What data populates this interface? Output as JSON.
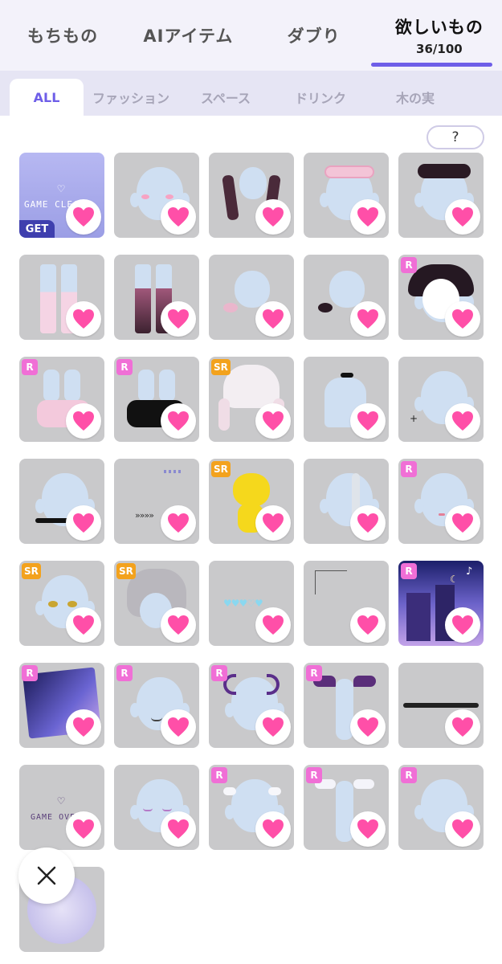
{
  "top_tabs": [
    {
      "label": "もちもの"
    },
    {
      "label": "AIアイテム"
    },
    {
      "label": "ダブり"
    },
    {
      "label": "欲しいもの",
      "count": "36/100"
    }
  ],
  "sub_tabs": [
    {
      "label": "ALL"
    },
    {
      "label": "ファッション"
    },
    {
      "label": "スペース"
    },
    {
      "label": "ドリンク"
    },
    {
      "label": "木の実"
    }
  ],
  "help_label": "?",
  "colors": {
    "accent": "#6e5ee8",
    "heart": "#ff4fa8",
    "rarity_r": "#f06fd6",
    "rarity_sr": "#f3a21d"
  },
  "tiles": [
    {
      "art": "game-clear",
      "badge": "",
      "overlay_text": "GAME CLEAR",
      "get_label": "GET"
    },
    {
      "art": "blush-face",
      "badge": ""
    },
    {
      "art": "cat-gloves",
      "badge": ""
    },
    {
      "art": "pink-braid-headband",
      "badge": ""
    },
    {
      "art": "black-braid-headband",
      "badge": ""
    },
    {
      "art": "pink-socks",
      "badge": ""
    },
    {
      "art": "purple-socks",
      "badge": ""
    },
    {
      "art": "pink-hair-ties",
      "badge": ""
    },
    {
      "art": "black-hair-ties",
      "badge": ""
    },
    {
      "art": "braided-buns",
      "badge": "R"
    },
    {
      "art": "pink-shoes",
      "badge": "R"
    },
    {
      "art": "black-shoes",
      "badge": "R"
    },
    {
      "art": "white-twintails",
      "badge": "SR"
    },
    {
      "art": "choker",
      "badge": ""
    },
    {
      "art": "face-sparkle",
      "badge": ""
    },
    {
      "art": "black-hairband",
      "badge": ""
    },
    {
      "art": "arrow-deco",
      "badge": ""
    },
    {
      "art": "yellow-cat",
      "badge": "SR"
    },
    {
      "art": "silver-hair-strand",
      "badge": ""
    },
    {
      "art": "mouth",
      "badge": "R"
    },
    {
      "art": "golden-eyes",
      "badge": "SR"
    },
    {
      "art": "silver-hair",
      "badge": "SR"
    },
    {
      "art": "heart-row",
      "badge": ""
    },
    {
      "art": "corner-frame",
      "badge": ""
    },
    {
      "art": "night-city-music",
      "badge": "R"
    },
    {
      "art": "night-city-card",
      "badge": "R"
    },
    {
      "art": "fangs",
      "badge": "R"
    },
    {
      "art": "demon-horns",
      "badge": "R"
    },
    {
      "art": "bat-wings",
      "badge": "R"
    },
    {
      "art": "status-bar",
      "badge": ""
    },
    {
      "art": "game-over",
      "badge": "",
      "overlay_text": "GAME OVER"
    },
    {
      "art": "closed-eyes",
      "badge": ""
    },
    {
      "art": "white-bows",
      "badge": "R"
    },
    {
      "art": "angel-wings",
      "badge": "R"
    },
    {
      "art": "plain-head",
      "badge": "R"
    },
    {
      "art": "partial-tile",
      "badge": ""
    }
  ]
}
